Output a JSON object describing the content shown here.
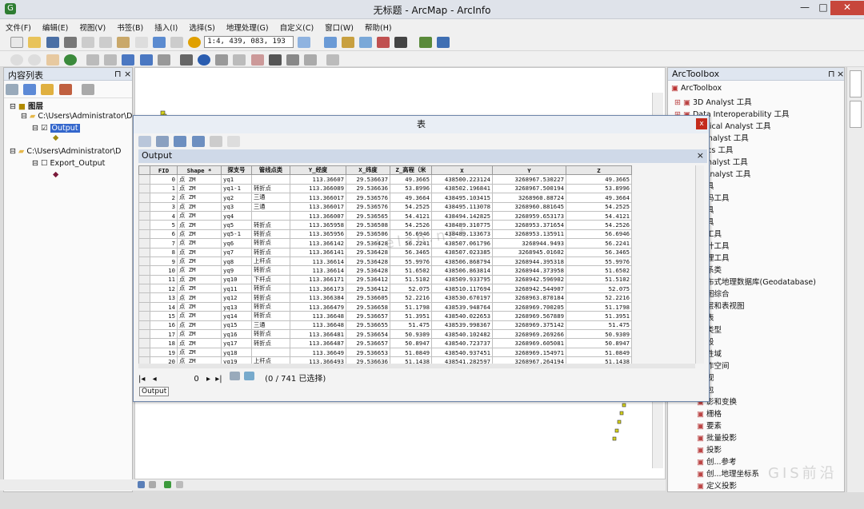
{
  "window": {
    "title": "无标题 - ArcMap - ArcInfo",
    "minimize": "—",
    "maximize": "□",
    "close": "✕"
  },
  "menu": [
    "文件(F)",
    "编辑(E)",
    "视图(V)",
    "书签(B)",
    "插入(I)",
    "选择(S)",
    "地理处理(G)",
    "自定义(C)",
    "窗口(W)",
    "帮助(H)"
  ],
  "toolbar": {
    "scale": "1:4, 439, 083, 193"
  },
  "toc": {
    "title": "内容列表",
    "pin": "⊓",
    "close": "×",
    "layers_label": "图层",
    "group1": "C:\\Users\\Administrator\\D",
    "layer1": "Output",
    "group2": "C:\\Users\\Administrator\\D",
    "layer2": "Export_Output"
  },
  "table_window": {
    "title": "表",
    "close": "x",
    "subtitle": "Output",
    "nav_record": "0",
    "record_status": "(0 / 741 已选择)",
    "tab": "Output"
  },
  "columns": [
    "FID",
    "Shape *",
    "探支号",
    "管线点类",
    "Y_经度",
    "X_纬度",
    "Z_高程（米",
    "X",
    "Y",
    "Z"
  ],
  "rows": [
    [
      "0",
      "点 ZM",
      "yq1",
      "",
      "113.36607",
      "29.536637",
      "49.3665",
      "438500.223124",
      "3268967.530227",
      "49.3665"
    ],
    [
      "1",
      "点 ZM",
      "yq1-1",
      "转折点",
      "113.366089",
      "29.536636",
      "53.8996",
      "438502.196841",
      "3268967.500194",
      "53.8996"
    ],
    [
      "2",
      "点 ZM",
      "yq2",
      "三通",
      "113.366017",
      "29.536576",
      "49.3664",
      "438495.103415",
      "3268960.88724",
      "49.3664"
    ],
    [
      "3",
      "点 ZM",
      "yq3",
      "三通",
      "113.366017",
      "29.536576",
      "54.2525",
      "438495.113078",
      "3268960.881645",
      "54.2525"
    ],
    [
      "4",
      "点 ZM",
      "yq4",
      "",
      "113.366007",
      "29.536565",
      "54.4121",
      "438494.142825",
      "3268959.653173",
      "54.4121"
    ],
    [
      "5",
      "点 ZM",
      "yq5",
      "转折点",
      "113.365958",
      "29.536508",
      "54.2526",
      "438489.310775",
      "3268953.371654",
      "54.2526"
    ],
    [
      "6",
      "点 ZM",
      "yq5-1",
      "转折点",
      "113.365956",
      "29.536506",
      "56.6946",
      "438489.133673",
      "3268953.135911",
      "56.6946"
    ],
    [
      "7",
      "点 ZM",
      "yq6",
      "转折点",
      "113.366142",
      "29.536428",
      "56.2241",
      "438507.061796",
      "3268944.9493",
      "56.2241"
    ],
    [
      "8",
      "点 ZM",
      "yq7",
      "转折点",
      "113.366141",
      "29.536428",
      "56.3465",
      "438507.023385",
      "3268945.01602",
      "56.3465"
    ],
    [
      "9",
      "点 ZM",
      "yq8",
      "上杆点",
      "113.36614",
      "29.536428",
      "55.9976",
      "438506.868794",
      "3268944.395318",
      "55.9976"
    ],
    [
      "10",
      "点 ZM",
      "yq9",
      "转折点",
      "113.36614",
      "29.536428",
      "51.6502",
      "438506.863814",
      "3268944.373958",
      "51.6502"
    ],
    [
      "11",
      "点 ZM",
      "yq10",
      "下杆点",
      "113.366171",
      "29.536412",
      "51.5102",
      "438509.933795",
      "3268942.596902",
      "51.5102"
    ],
    [
      "12",
      "点 ZM",
      "yq11",
      "转折点",
      "113.366173",
      "29.536412",
      "52.075",
      "438510.117694",
      "3268942.544907",
      "52.075"
    ],
    [
      "13",
      "点 ZM",
      "yq12",
      "转折点",
      "113.366384",
      "29.536605",
      "52.2216",
      "438530.670197",
      "3268963.870184",
      "52.2216"
    ],
    [
      "14",
      "点 ZM",
      "yq13",
      "转折点",
      "113.366479",
      "29.536658",
      "51.1798",
      "438539.948764",
      "3268969.700205",
      "51.1798"
    ],
    [
      "15",
      "点 ZM",
      "yq14",
      "转折点",
      "113.36648",
      "29.536657",
      "51.3951",
      "438540.022653",
      "3268969.567889",
      "51.3951"
    ],
    [
      "16",
      "点 ZM",
      "yq15",
      "三通",
      "113.36648",
      "29.536655",
      "51.475",
      "438539.998367",
      "3268969.375142",
      "51.475"
    ],
    [
      "17",
      "点 ZM",
      "yq16",
      "转折点",
      "113.366481",
      "29.536654",
      "50.9309",
      "438540.102482",
      "3268969.269266",
      "50.9309"
    ],
    [
      "18",
      "点 ZM",
      "yq17",
      "转折点",
      "113.366487",
      "29.536657",
      "50.8947",
      "438540.723737",
      "3268969.605081",
      "50.8947"
    ],
    [
      "19",
      "点 ZM",
      "yq18",
      "",
      "113.36649",
      "29.536653",
      "51.0849",
      "438540.937451",
      "3268969.154971",
      "51.0849"
    ],
    [
      "20",
      "点 ZM",
      "yq19",
      "上杆点",
      "113.366493",
      "29.536636",
      "51.1438",
      "438541.282597",
      "3268967.264194",
      "51.1438"
    ]
  ],
  "toolbox": {
    "title": "ArcToolbox",
    "pin": "⊓",
    "close": "×",
    "root": "ArcToolbox",
    "items": [
      "3D Analyst 工具",
      "Data Interoperability 工具",
      "atistical Analyst 工具",
      "rk Analyst 工具",
      "natics 工具",
      "al Analyst 工具",
      "ng Analyst 工具",
      "具",
      "码工具",
      "具",
      "具",
      "工具",
      "计工具",
      "理工具",
      "系类",
      "布式地理数据库(Geodatabase)",
      "图综合",
      "层和表视图",
      "表",
      "类型",
      "段",
      "性域",
      "作空间",
      "视",
      "包",
      "影和变换",
      "栅格",
      "要素",
      "批量投影",
      "投影",
      "创...参考",
      "创...地理坐标系",
      "定义投影"
    ]
  },
  "watermark": {
    "site": "telab.net",
    "brand": "GIS前沿"
  }
}
